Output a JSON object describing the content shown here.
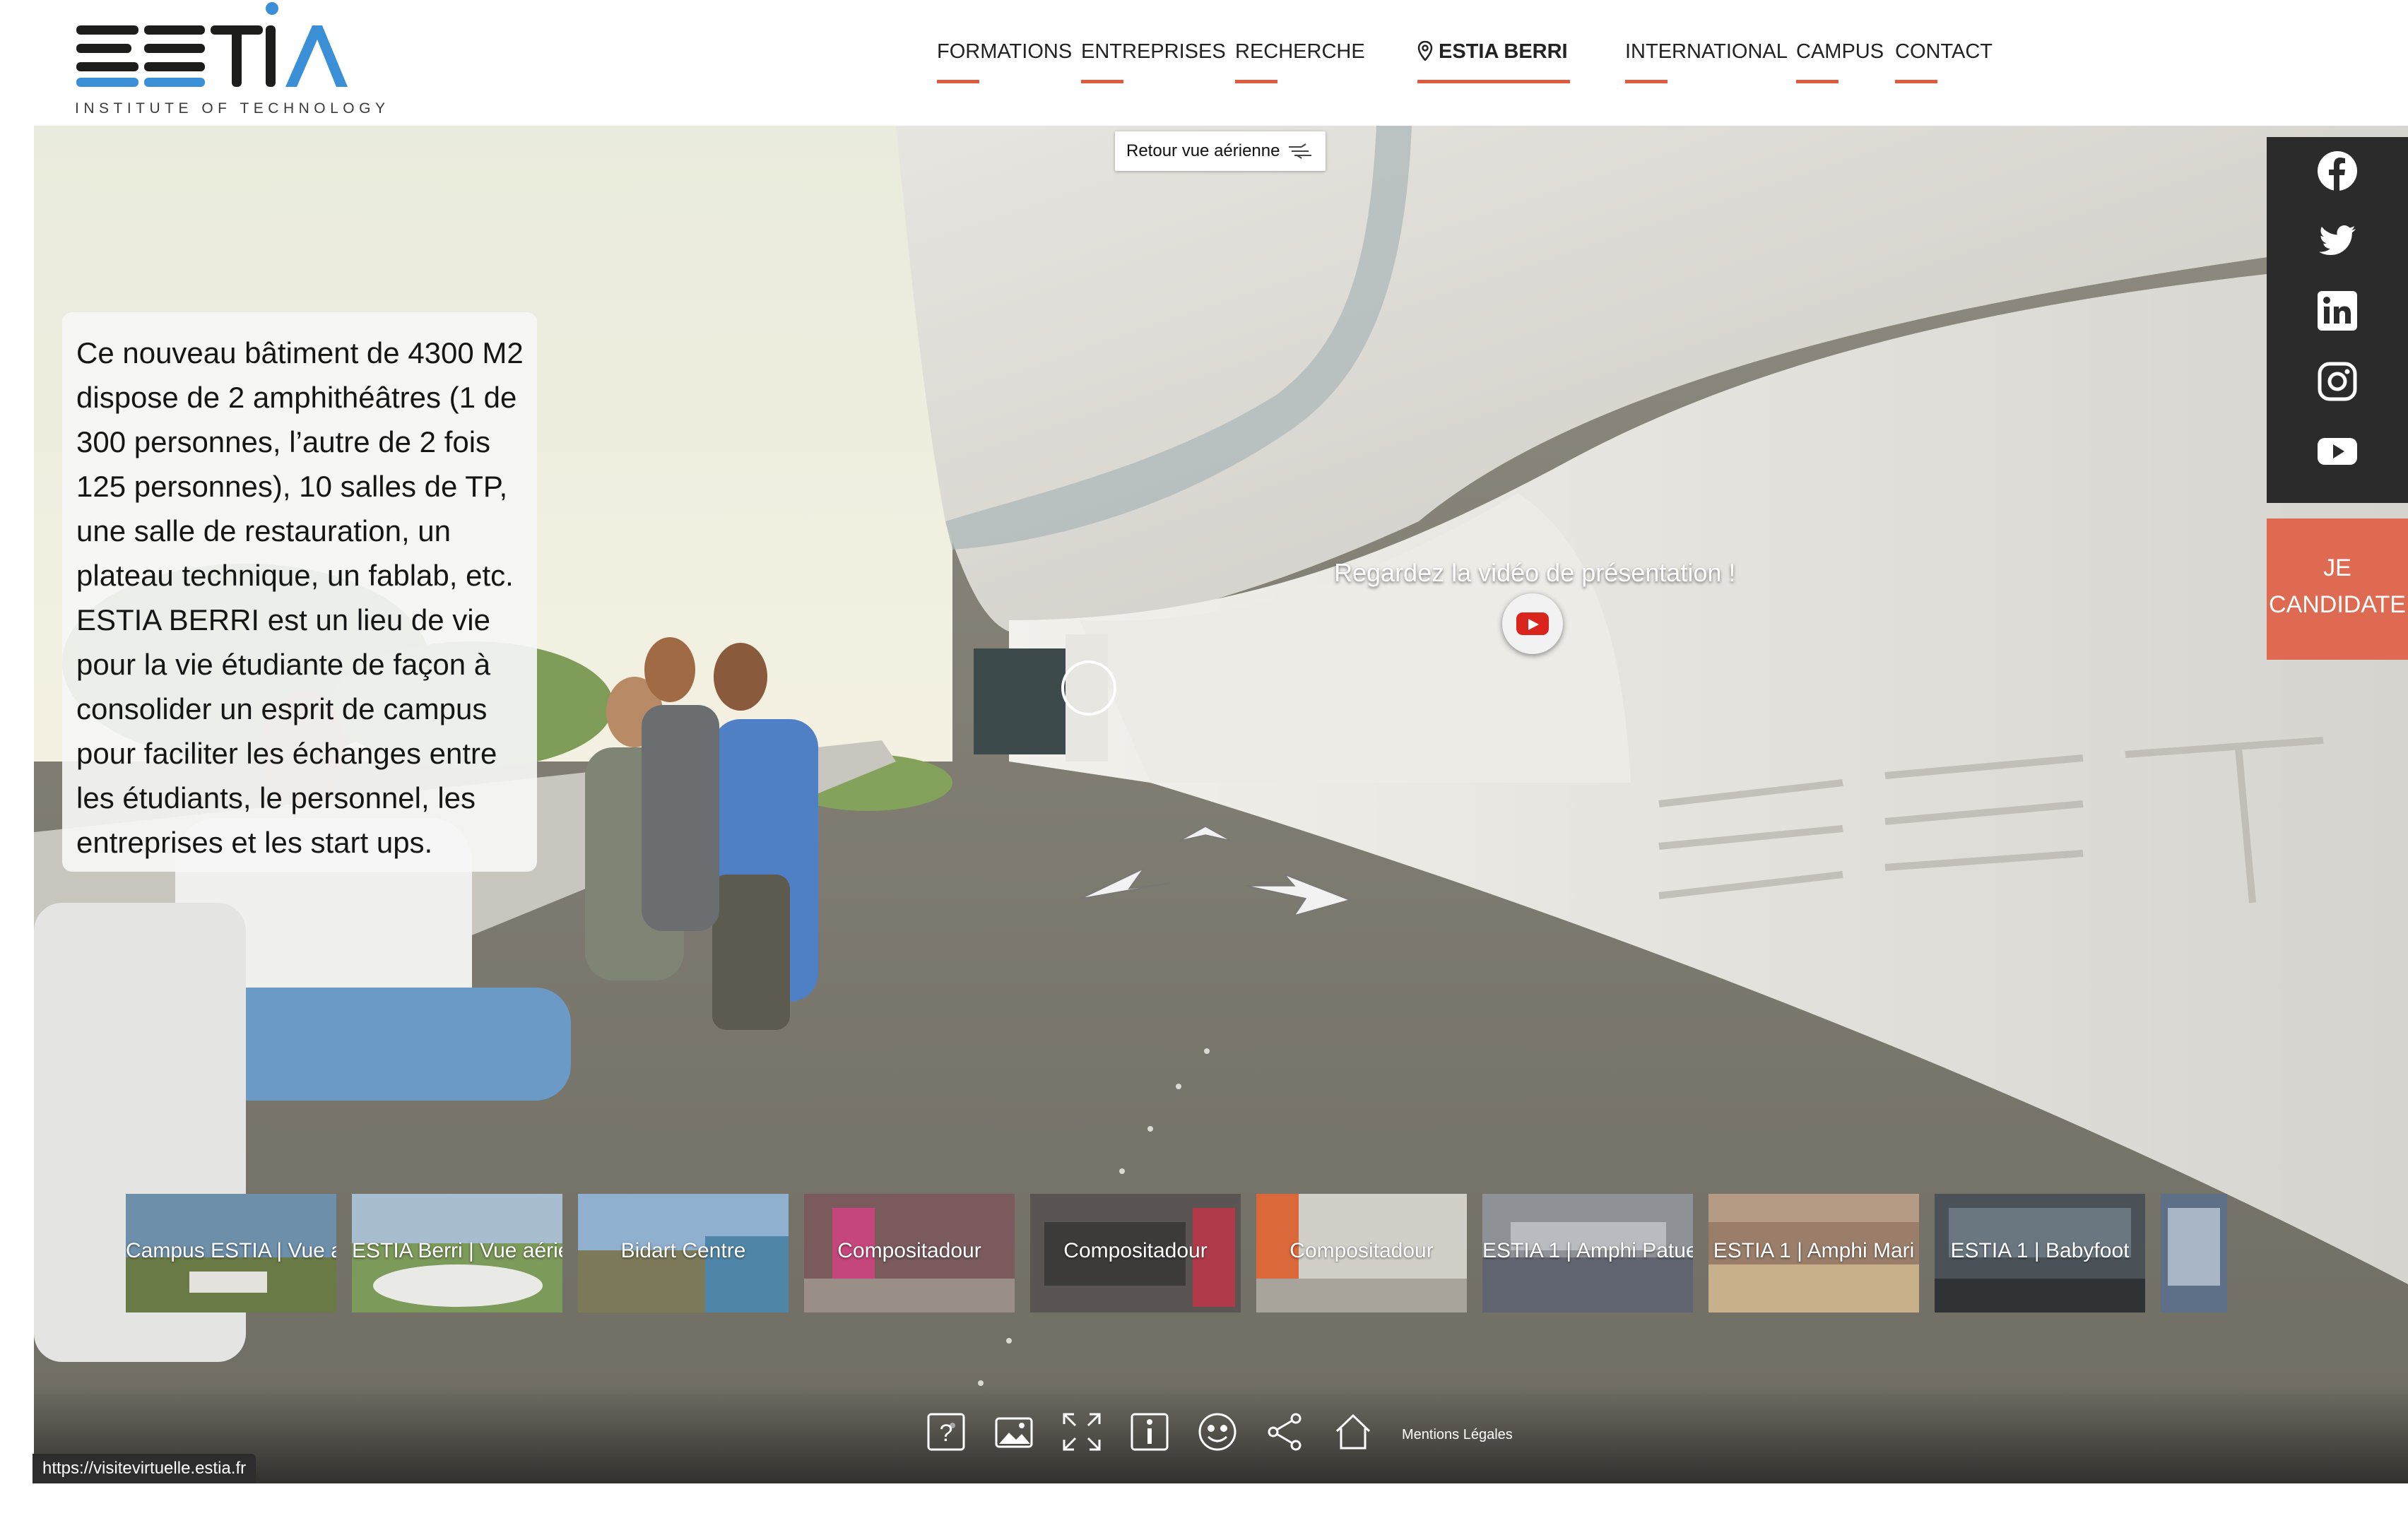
{
  "brand": {
    "logo_text": "ESTIA",
    "tagline": "INSTITUTE OF TECHNOLOGY",
    "accent_blue": "#3a8fd6",
    "accent_red": "#e05a3f"
  },
  "nav": {
    "items": [
      {
        "label": "FORMATIONS"
      },
      {
        "label": "ENTREPRISES"
      },
      {
        "label": "RECHERCHE"
      },
      {
        "label": "ESTIA BERRI",
        "active": true,
        "icon": "location-pin-icon"
      },
      {
        "label": "INTERNATIONAL"
      },
      {
        "label": "CAMPUS"
      },
      {
        "label": "CONTACT"
      }
    ]
  },
  "tour": {
    "retour_label": "Retour vue aérienne",
    "info_text": "Ce nouveau bâtiment de 4300 M2 dispose de 2 amphithéâtres (1 de 300 personnes, l’autre de 2 fois 125 personnes), 10 salles de TP, une salle de restauration, un plateau technique, un fablab, etc. ESTIA BERRI est un lieu de vie pour la vie étudiante de façon à consolider un esprit de campus pour faciliter les échanges entre les étudiants, le personnel, les entreprises et les start ups.",
    "video_label": "Regardez la vidéo de présentation !",
    "thumbnails": [
      {
        "label": "Campus ESTIA | Vue a"
      },
      {
        "label": "ESTIA Berri | Vue aérie"
      },
      {
        "label": "Bidart Centre"
      },
      {
        "label": "Compositadour"
      },
      {
        "label": "Compositadour"
      },
      {
        "label": "Compositadour"
      },
      {
        "label": "ESTIA 1 | Amphi Patue"
      },
      {
        "label": "ESTIA 1 | Amphi Mari"
      },
      {
        "label": "ESTIA 1 | Babyfoot"
      },
      {
        "label": ""
      }
    ],
    "toolbar": {
      "icons": [
        "help-icon",
        "gallery-icon",
        "fullscreen-icon",
        "info-icon",
        "vr-mask-icon",
        "share-icon",
        "home-icon"
      ],
      "mentions_label": "Mentions Légales"
    }
  },
  "status_url": "https://visitevirtuelle.estia.fr",
  "social": {
    "icons": [
      "facebook-icon",
      "twitter-icon",
      "linkedin-icon",
      "instagram-icon",
      "youtube-icon"
    ],
    "cta_line1": "JE",
    "cta_line2": "CANDIDATE"
  }
}
